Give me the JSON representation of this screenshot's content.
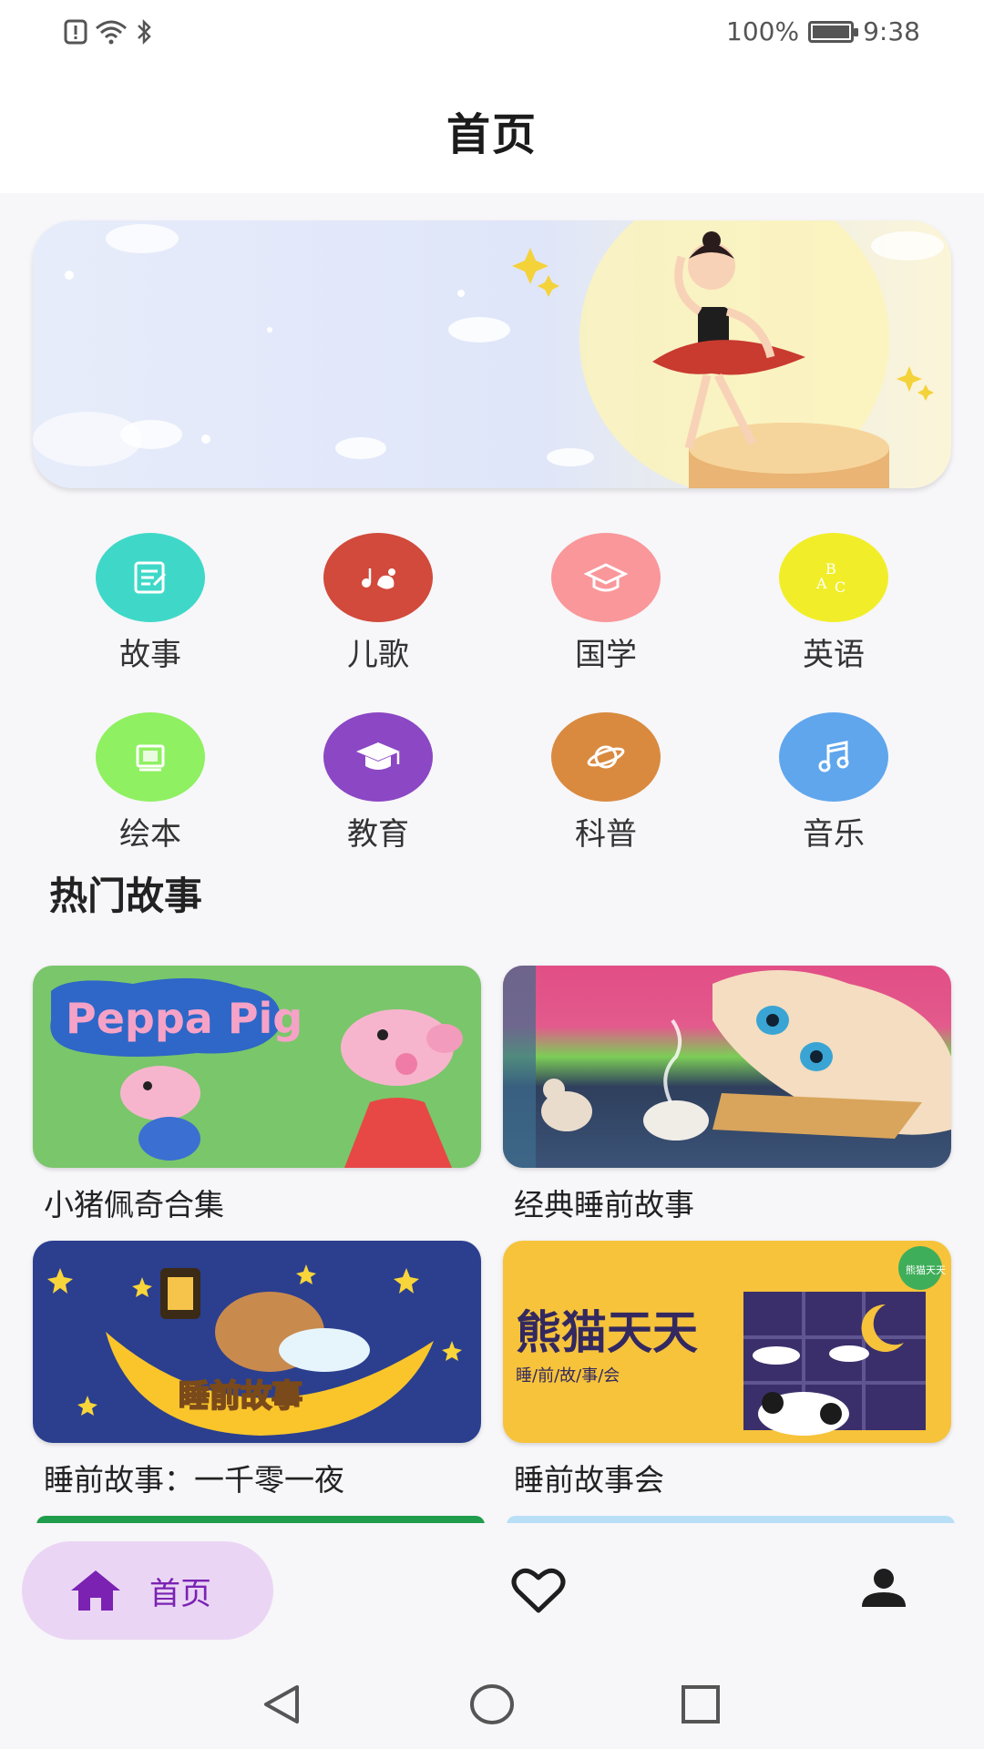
{
  "status_bar": {
    "battery": "100%",
    "time": "9:38"
  },
  "header": {
    "title": "首页"
  },
  "banner": {
    "description_icon": "ballerina-illustration"
  },
  "categories": [
    {
      "label": "故事",
      "icon": "story-icon",
      "color": "#3fd8c8"
    },
    {
      "label": "儿歌",
      "icon": "song-icon",
      "color": "#d14a3c"
    },
    {
      "label": "国学",
      "icon": "classics-icon",
      "color": "#f9979a"
    },
    {
      "label": "英语",
      "icon": "english-icon",
      "color": "#f1ee29"
    },
    {
      "label": "绘本",
      "icon": "picture-book-icon",
      "color": "#8ff061"
    },
    {
      "label": "教育",
      "icon": "education-icon",
      "color": "#8b47c4"
    },
    {
      "label": "科普",
      "icon": "science-icon",
      "color": "#d98a3f"
    },
    {
      "label": "音乐",
      "icon": "music-icon",
      "color": "#5fa6ed"
    }
  ],
  "hot_section": {
    "title": "热门故事"
  },
  "stories": [
    {
      "title": "小猪佩奇合集",
      "cover_text": "Peppa Pig"
    },
    {
      "title": "经典睡前故事"
    },
    {
      "title": "睡前故事：一千零一夜",
      "cover_text": "睡前故事"
    },
    {
      "title": "睡前故事会",
      "cover_text": "熊猫天天",
      "cover_subtext": "睡/前/故/事/会",
      "badge": "熊猫天天"
    }
  ],
  "bottom_nav": {
    "home_label": "首页",
    "home_color": "#7b22b3",
    "home_pill_color": "#ead6f4"
  }
}
